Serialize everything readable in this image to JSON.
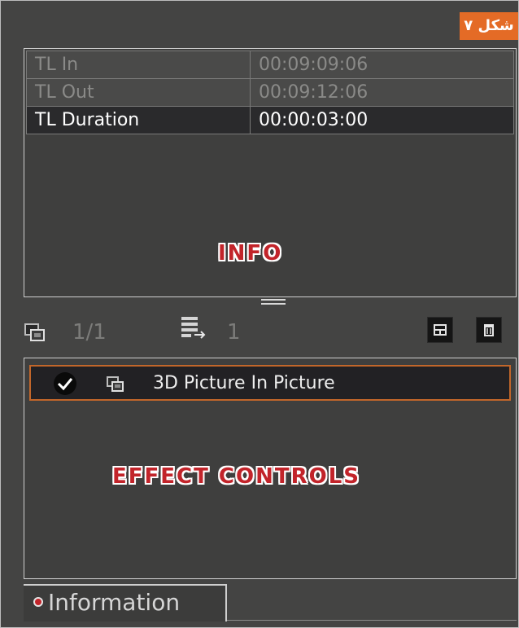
{
  "figure_label": "شکل ۷",
  "info": {
    "rows": [
      {
        "key": "TL In",
        "value": "00:09:09:06"
      },
      {
        "key": "TL Out",
        "value": "00:09:12:06"
      },
      {
        "key": "TL Duration",
        "value": "00:00:03:00"
      }
    ],
    "watermark": "INFO"
  },
  "toolbar": {
    "layer_count": "1/1",
    "effect_count": "1",
    "icons": [
      "layer-icon",
      "effect-list-icon",
      "expand-view-icon",
      "delete-icon"
    ]
  },
  "effects": {
    "items": [
      {
        "label": "3D Picture In Picture",
        "enabled": true
      }
    ],
    "watermark": "EFFECT CONTROLS"
  },
  "tabs": {
    "active": "Information"
  },
  "colors": {
    "panel_bg": "#444443",
    "accent_border": "#c2662a",
    "watermark_red": "#c2242a",
    "figure_label_bg": "#e46b26"
  }
}
